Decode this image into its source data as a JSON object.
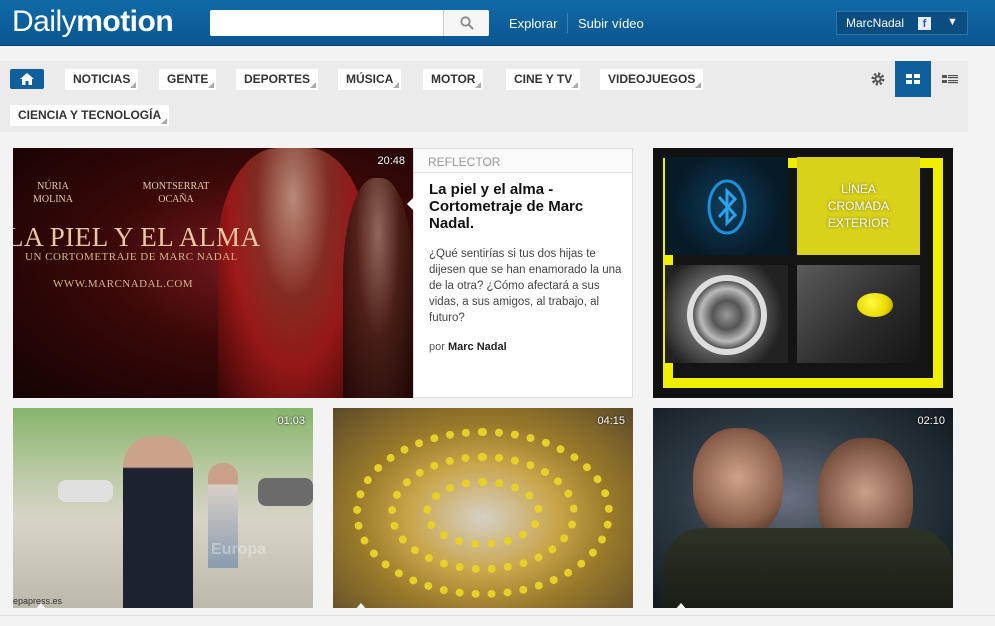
{
  "header": {
    "logo_part1": "Daily",
    "logo_part2": "motion",
    "search_placeholder": "",
    "search_icon": "search-icon",
    "nav": {
      "explore": "Explorar",
      "upload": "Subir vídeo"
    },
    "user": {
      "name": "MarcNadal",
      "fb_badge": "f",
      "dropdown_icon": "chevron-down-icon"
    }
  },
  "categories": {
    "home_icon": "home-icon",
    "items": [
      "NOTICIAS",
      "GENTE",
      "DEPORTES",
      "MÚSICA",
      "MOTOR",
      "CINE Y TV",
      "VIDEOJUEGOS",
      "CIENCIA Y TECNOLOGÍA"
    ],
    "view_tools": [
      "gear-icon",
      "grid-view-icon",
      "list-view-icon"
    ]
  },
  "featured": {
    "duration": "20:48",
    "label": "REFLECTOR",
    "title": "La piel y el alma - Cortometraje de Marc Nadal.",
    "description": "¿Qué sentirías si tus dos hijas te dijesen que se han enamorado la una de la otra? ¿Cómo afectará a sus vidas, a sus amigos, al trabajo, al futuro?",
    "by_prefix": "por",
    "author": "Marc Nadal",
    "poster": {
      "actor1_first": "NÚRIA",
      "actor1_last": "MOLINA",
      "actor2_first": "MONTSERRAT",
      "actor2_last": "OCAÑA",
      "title": "LA PIEL Y EL ALMA",
      "subtitle": "UN CORTOMETRAJE DE MARC NADAL",
      "url": "WWW.MARCNADAL.COM"
    }
  },
  "ad": {
    "text_line1": "LÍNEA",
    "text_line2": "CROMADA",
    "text_line3": "EXTERIOR"
  },
  "videos": [
    {
      "duration": "01:03",
      "watermark": "epapress.es",
      "watermark2": "Europa"
    },
    {
      "duration": "04:15"
    },
    {
      "duration": "02:10"
    }
  ]
}
